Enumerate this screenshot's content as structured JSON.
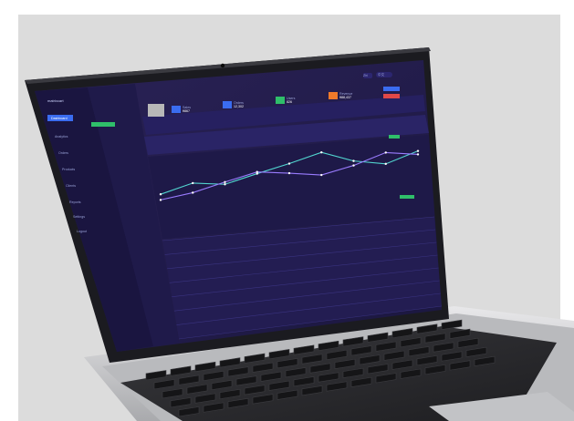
{
  "colors": {
    "backdrop": "#dcdcdc",
    "bezel": "#1b1b20",
    "screen_bg": "#221c48",
    "sidebar_bg": "#1a1540",
    "accent_blue": "#3a6cf0",
    "accent_green": "#2fbf6a",
    "accent_orange": "#f07a2a",
    "accent_red": "#e04848",
    "line_cyan": "#52d6d0",
    "line_purple": "#9a7cff",
    "laptop_silver": "#c9cacc",
    "keyboard": "#2b2b2e"
  },
  "app": {
    "logo_text": "matrixcart",
    "header_buttons": [
      "Zhi",
      "中文"
    ]
  },
  "sidebar": {
    "items": [
      "Dashboard",
      "Analytics",
      "Orders",
      "Products",
      "Clients",
      "Reports",
      "Settings",
      "Logout"
    ]
  },
  "stats": [
    {
      "label": "Sales",
      "value": "¥867",
      "color": "#3a6cf0"
    },
    {
      "label": "Orders",
      "value": "12,302",
      "color": "#3a6cf0"
    },
    {
      "label": "Users",
      "value": "826",
      "color": "#2fbf6a"
    },
    {
      "label": "Revenue",
      "value": "¥88,437",
      "color": "#f07a2a"
    }
  ],
  "chart_data": {
    "type": "line",
    "series": [
      {
        "values": [
          40,
          55,
          48,
          62,
          75,
          90,
          70,
          60,
          78
        ]
      },
      {
        "values": [
          30,
          38,
          52,
          65,
          58,
          50,
          62,
          80,
          72
        ]
      }
    ],
    "categories": [
      "1",
      "2",
      "3",
      "4",
      "5",
      "6",
      "7",
      "8",
      "9"
    ],
    "ylim": [
      0,
      100
    ]
  },
  "table": {
    "rows": 7,
    "cols": 4
  }
}
